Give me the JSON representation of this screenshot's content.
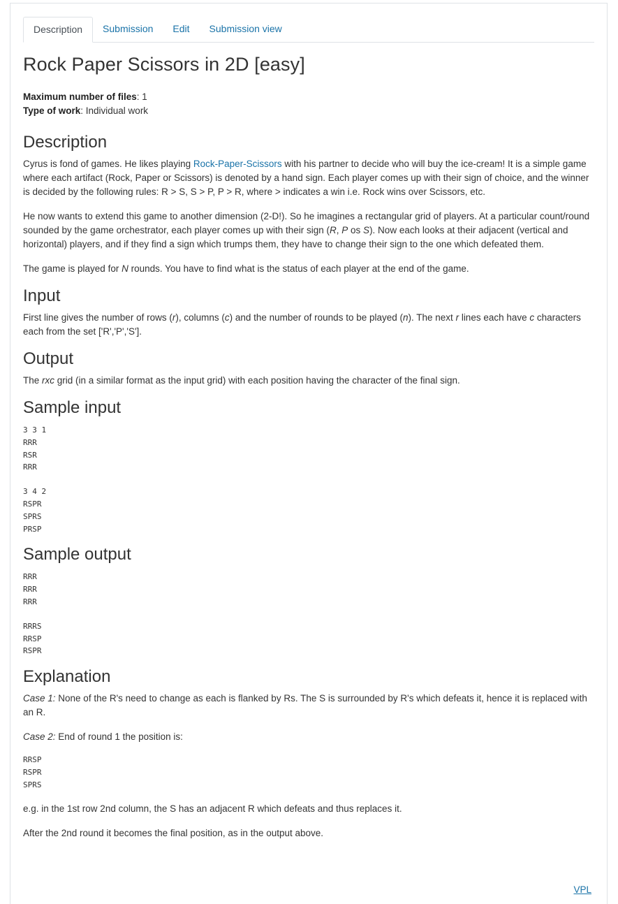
{
  "tabs": [
    "Description",
    "Submission",
    "Edit",
    "Submission view"
  ],
  "title": "Rock Paper Scissors in 2D [easy]",
  "meta": {
    "files_label": "Maximum number of files",
    "files_value": ": 1",
    "work_label": "Type of work",
    "work_value": ": Individual work"
  },
  "description": {
    "heading": "Description",
    "p1_before": "Cyrus is fond of games. He likes playing ",
    "p1_link": "Rock-Paper-Scissors",
    "p1_after": " with his partner to decide who will buy the ice-cream! It is a simple game where each artifact (Rock, Paper or Scissors) is denoted by a hand sign. Each player comes up with their sign of choice, and the winner is decided by the following rules: R > S, S > P, P > R, where > indicates a win i.e. Rock wins over Scissors, etc.",
    "p2_a": "He now wants to extend this game to another dimension (2-D!). So he imagines a rectangular grid of players. At a particular count/round sounded by the game orchestrator, each player comes up with their sign (",
    "p2_R": "R",
    "p2_b": ", ",
    "p2_P": "P",
    "p2_c": " os ",
    "p2_S": "S",
    "p2_d": "). Now each looks at their adjacent (vertical and horizontal) players, and if they find a sign which trumps them, they have to change their sign to the one which defeated them.",
    "p3_a": "The game is played for ",
    "p3_N": "N",
    "p3_b": " rounds. You have to find what is the status of each player at the end of the game."
  },
  "input": {
    "heading": "Input",
    "a": "First line gives the number of rows (",
    "r": "r",
    "b": "), columns (",
    "c": "c",
    "d": ") and the number of rounds to be played (",
    "n": "n",
    "e": "). The next ",
    "r2": "r",
    "f": " lines each have ",
    "c2": "c",
    "g": " characters each from the set ['R','P','S']."
  },
  "output": {
    "heading": "Output",
    "a": "The ",
    "rxc": "rxc",
    "b": " grid (in a similar format as the input grid) with each position having the character of the final sign."
  },
  "sample_input": {
    "heading": "Sample input",
    "case1": "3 3 1\nRRR\nRSR\nRRR",
    "case2": "3 4 2\nRSPR\nSPRS\nPRSP"
  },
  "sample_output": {
    "heading": "Sample output",
    "case1": "RRR\nRRR\nRRR",
    "case2": "RRRS\nRRSP\nRSPR"
  },
  "explanation": {
    "heading": "Explanation",
    "case1_label": "Case 1:",
    "case1_text": " None of the R's need to change as each is flanked by Rs. The S is surrounded by R's which defeats it, hence it is replaced with an R.",
    "case2_label": "Case 2:",
    "case2_text": " End of round 1 the position is:",
    "grid": "RRSP\nRSPR\nSPRS",
    "note": "e.g. in the 1st row 2nd column, the S has an adjacent R which defeats and thus replaces it.",
    "final": "After the 2nd round it becomes the final position, as in the output above."
  },
  "footer_link": "VPL"
}
